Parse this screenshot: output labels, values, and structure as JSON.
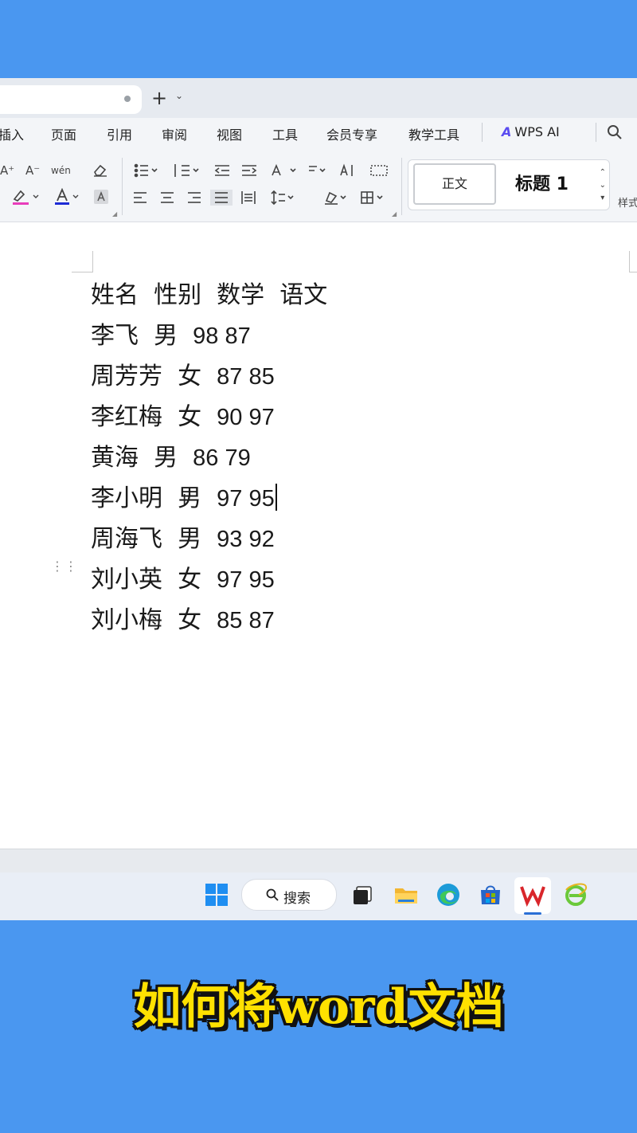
{
  "tabs": {
    "new_tab": "+",
    "new_tab_caret": "⌄"
  },
  "menu": {
    "items": [
      "插入",
      "页面",
      "引用",
      "审阅",
      "视图",
      "工具",
      "会员专享",
      "教学工具"
    ],
    "wps_ai": "WPS AI",
    "wps_ai_logo": "A"
  },
  "ribbon": {
    "font_grow": "A⁺",
    "font_shrink": "A⁻",
    "phonetic": "wén",
    "clear_format": "⌫",
    "styles": {
      "normal": "正文",
      "heading1": "标题 1",
      "label": "样式"
    }
  },
  "document": {
    "lines": [
      {
        "text": "姓名  性别  数学  语文",
        "nums": ""
      },
      {
        "text": "李飞  男  ",
        "nums": "98 87"
      },
      {
        "text": "周芳芳  女  ",
        "nums": "87 85"
      },
      {
        "text": "李红梅  女  ",
        "nums": "90 97"
      },
      {
        "text": "黄海  男  ",
        "nums": "86 79"
      },
      {
        "text": "李小明  男  ",
        "nums": "97 95"
      },
      {
        "text": "周海飞  男  ",
        "nums": "93 92"
      },
      {
        "text": "刘小英  女  ",
        "nums": "97 95"
      },
      {
        "text": "刘小梅  女  ",
        "nums": "85 87"
      }
    ]
  },
  "taskbar": {
    "search_label": "搜索"
  },
  "caption": "如何将word文档",
  "colors": {
    "background": "#4a97f0",
    "caption": "#ffe100",
    "wps_red": "#d9262b"
  }
}
